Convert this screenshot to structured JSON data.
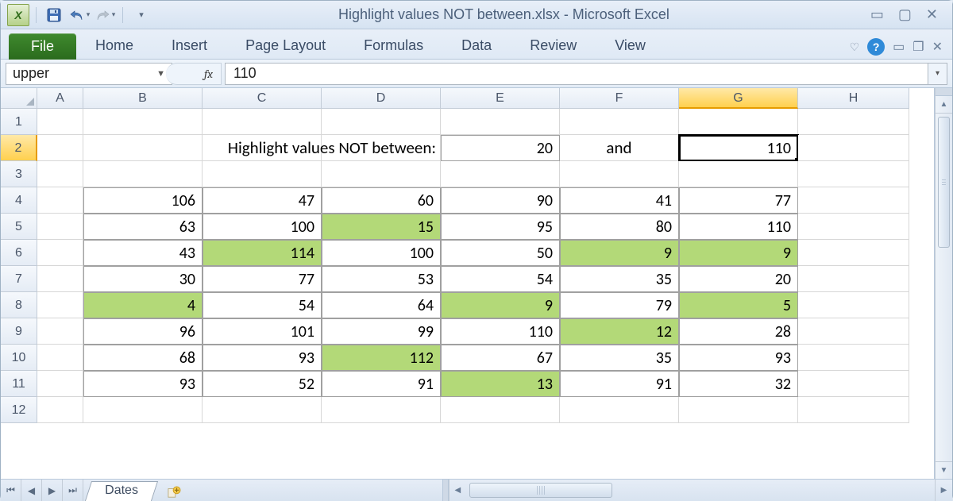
{
  "window": {
    "title": "Highlight values NOT between.xlsx  -  Microsoft Excel"
  },
  "ribbon": {
    "file": "File",
    "tabs": [
      "Home",
      "Insert",
      "Page Layout",
      "Formulas",
      "Data",
      "Review",
      "View"
    ]
  },
  "namebox": "upper",
  "fx_label": "fx",
  "formula_value": "110",
  "columns": [
    {
      "label": "A",
      "w": 58
    },
    {
      "label": "B",
      "w": 150
    },
    {
      "label": "C",
      "w": 150
    },
    {
      "label": "D",
      "w": 150
    },
    {
      "label": "E",
      "w": 150
    },
    {
      "label": "F",
      "w": 150
    },
    {
      "label": "G",
      "w": 150
    },
    {
      "label": "H",
      "w": 140
    }
  ],
  "active_col": "G",
  "active_row": 2,
  "row_count": 12,
  "prompt_text": "Highlight values NOT between:",
  "and_text": "and",
  "lower_value": "20",
  "upper_value": "110",
  "data_rows": [
    [
      106,
      47,
      60,
      90,
      41,
      77
    ],
    [
      63,
      100,
      15,
      95,
      80,
      110
    ],
    [
      43,
      114,
      100,
      50,
      9,
      9
    ],
    [
      30,
      77,
      53,
      54,
      35,
      20
    ],
    [
      4,
      54,
      64,
      9,
      79,
      5
    ],
    [
      96,
      101,
      99,
      110,
      12,
      28
    ],
    [
      68,
      93,
      112,
      67,
      35,
      93
    ],
    [
      93,
      52,
      91,
      13,
      91,
      32
    ]
  ],
  "highlights": [
    [
      false,
      false,
      false,
      false,
      false,
      false
    ],
    [
      false,
      false,
      true,
      false,
      false,
      false
    ],
    [
      false,
      true,
      false,
      false,
      true,
      true
    ],
    [
      false,
      false,
      false,
      false,
      false,
      false
    ],
    [
      true,
      false,
      false,
      true,
      false,
      true
    ],
    [
      false,
      false,
      false,
      false,
      true,
      false
    ],
    [
      false,
      false,
      true,
      false,
      false,
      false
    ],
    [
      false,
      false,
      false,
      true,
      false,
      false
    ]
  ],
  "sheet_tab": "Dates"
}
